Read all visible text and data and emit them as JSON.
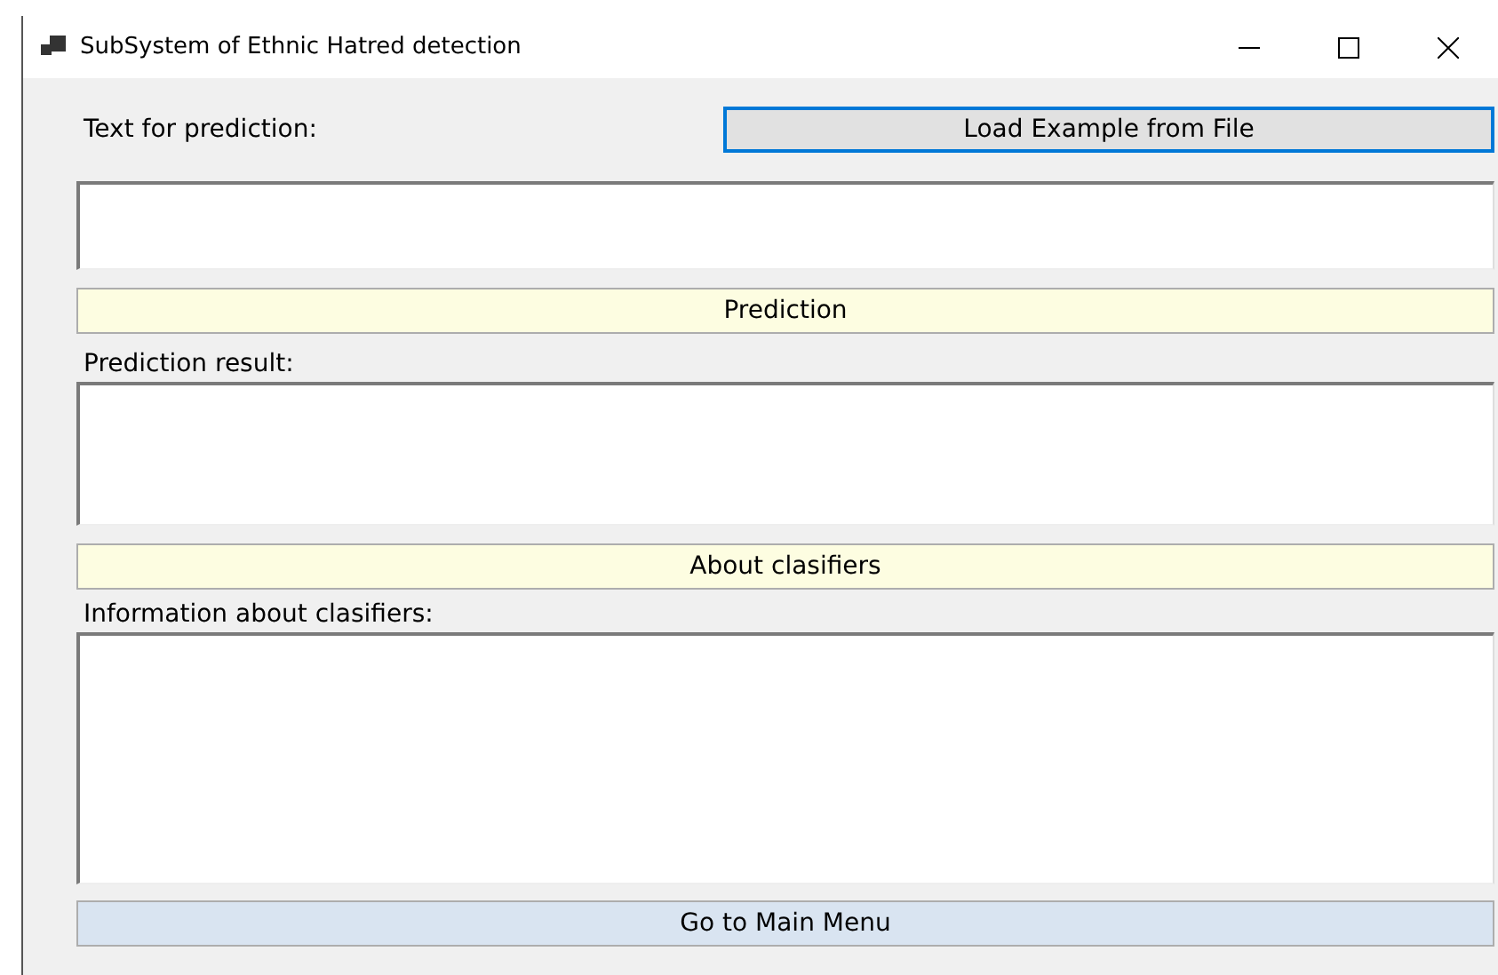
{
  "window": {
    "title": "SubSystem of Ethnic Hatred detection"
  },
  "input_label": "Text for prediction:",
  "load_button": {
    "label": "Load Example from File",
    "focused": true
  },
  "prediction_button": {
    "label": "Prediction"
  },
  "result_label": "Prediction result:",
  "about_button": {
    "label": "About clasifiers"
  },
  "info_label": "Information about clasifiers:",
  "main_menu_button": {
    "label": "Go to Main Menu"
  }
}
